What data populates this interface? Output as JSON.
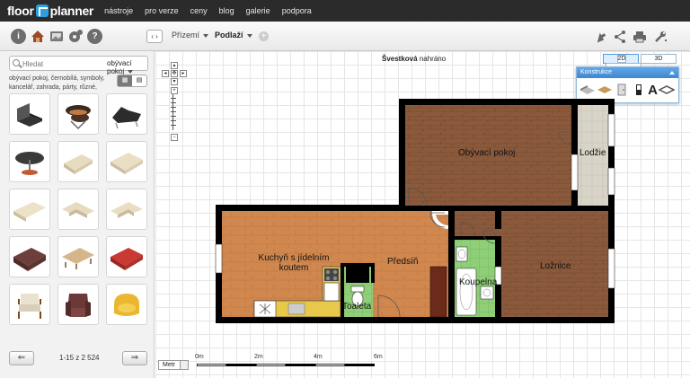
{
  "app": {
    "logo_left": "floor",
    "logo_right": "planner",
    "nav": [
      "nástroje",
      "pro verze",
      "ceny",
      "blog",
      "galerie",
      "podpora"
    ]
  },
  "toolbar": {
    "left_icons": [
      "info-icon",
      "house-icon",
      "photo-icon",
      "gear-icon",
      "help-icon"
    ],
    "nav_arrows": "‹ ›",
    "floor_current": "Přízemí",
    "floor_level": "Podlaží",
    "right_icons": [
      "share-export-icon",
      "share-icon",
      "print-icon",
      "settings-wrench-icon"
    ]
  },
  "sidebar": {
    "search_placeholder": "Hledat",
    "category": "obývací pokoj",
    "tags": "obývací pokoj, černobílá, symboly, kancelář, zahrada, párty, různé,",
    "items": [
      {
        "name": "black-chair"
      },
      {
        "name": "lounge-chair"
      },
      {
        "name": "recliner"
      },
      {
        "name": "round-table"
      },
      {
        "name": "cream-sofa"
      },
      {
        "name": "cream-sofa-2"
      },
      {
        "name": "cream-sofa-long"
      },
      {
        "name": "corner-sofa"
      },
      {
        "name": "corner-sofa-2"
      },
      {
        "name": "brown-sofa"
      },
      {
        "name": "beige-sofa"
      },
      {
        "name": "red-sofa"
      },
      {
        "name": "wooden-armchair"
      },
      {
        "name": "brown-armchair"
      },
      {
        "name": "yellow-armchair"
      }
    ],
    "pager_text": "1-15 z 2 524",
    "prev_label": "⇐",
    "next_label": "⇒"
  },
  "canvas": {
    "plan_name": "Švestková",
    "plan_status": "nahráno",
    "view_2d": "2D",
    "view_3d": "3D",
    "construct_title": "Konstrukce",
    "construct_text_tool": "A",
    "unit": "Metr",
    "scale_labels": [
      "0m",
      "2m",
      "4m",
      "6m"
    ]
  },
  "rooms": {
    "living": "Obývací pokoj",
    "loggia": "Lodžie",
    "kitchen": "Kuchyň s jídelním koutem",
    "hall": "Předsíň",
    "bath": "Koupelna",
    "toilet": "Toaleta",
    "bedroom": "Ložnice"
  },
  "colors": {
    "wall": "#000000",
    "floor_wood": "#8b5a3c",
    "floor_kitchen": "#d1884f",
    "floor_bath": "#8ecf77",
    "accent": "#3d86cf"
  }
}
